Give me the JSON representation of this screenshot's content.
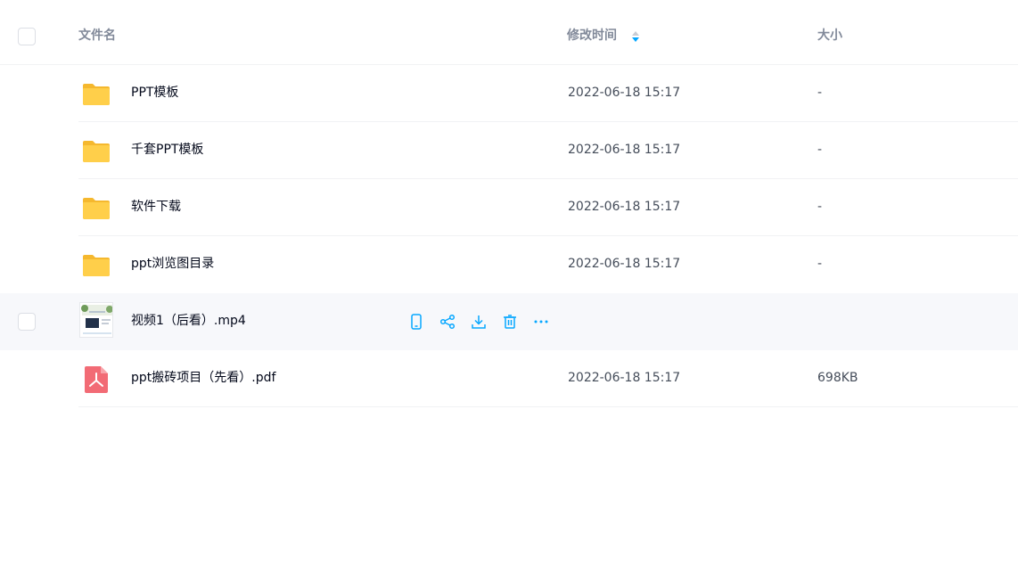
{
  "header": {
    "name_label": "文件名",
    "time_label": "修改时间",
    "size_label": "大小"
  },
  "files": [
    {
      "name": "PPT模板",
      "time": "2022-06-18 15:17",
      "size": "-",
      "type": "folder-icon"
    },
    {
      "name": "千套PPT模板",
      "time": "2022-06-18 15:17",
      "size": "-",
      "type": "folder-icon"
    },
    {
      "name": "软件下载",
      "time": "2022-06-18 15:17",
      "size": "-",
      "type": "folder-icon"
    },
    {
      "name": "ppt浏览图目录",
      "time": "2022-06-18 15:17",
      "size": "-",
      "type": "folder-icon"
    },
    {
      "name": "视频1（后看）.mp4",
      "time": "",
      "size": "",
      "type": "video-thumbnail"
    },
    {
      "name": "ppt搬砖项目（先看）.pdf",
      "time": "2022-06-18 15:17",
      "size": "698KB",
      "type": "pdf-icon"
    }
  ],
  "colors": {
    "accent": "#06a7ff",
    "folder": "#ffc43f",
    "pdf": "#f26b75",
    "hover_row": "#f7f8fb"
  }
}
